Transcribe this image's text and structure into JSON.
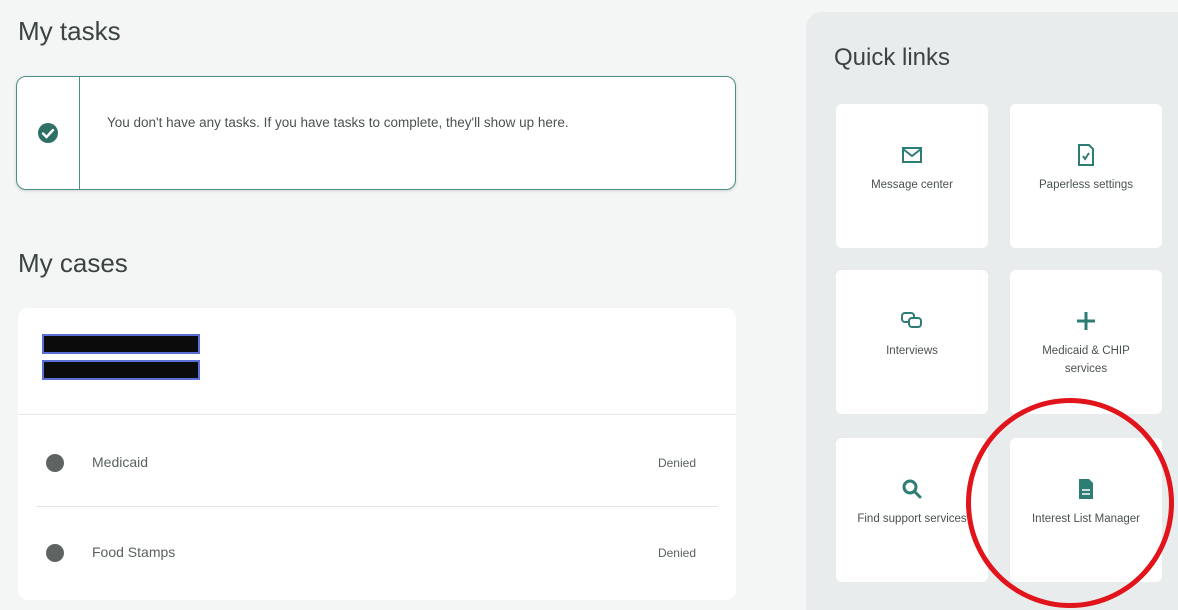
{
  "tasks": {
    "title": "My tasks",
    "message": "You don't have any tasks. If you have tasks to complete, they'll show up here."
  },
  "cases": {
    "title": "My cases",
    "rows": [
      {
        "name": "Medicaid",
        "status": "Denied"
      },
      {
        "name": "Food Stamps",
        "status": "Denied"
      }
    ]
  },
  "quick_links": {
    "title": "Quick links",
    "tiles": [
      {
        "label": "Message center",
        "icon": "mail-icon"
      },
      {
        "label": "Paperless settings",
        "icon": "document-icon"
      },
      {
        "label": "Interviews",
        "icon": "chat-icon"
      },
      {
        "label": "Medicaid & CHIP services",
        "icon": "plus-icon"
      },
      {
        "label": "Find support services",
        "icon": "search-icon"
      },
      {
        "label": "Interest List Manager",
        "icon": "document-icon"
      }
    ]
  },
  "colors": {
    "accent": "#2e7d74",
    "annotation": "#e0141a",
    "redaction": "#0b0b0b"
  }
}
